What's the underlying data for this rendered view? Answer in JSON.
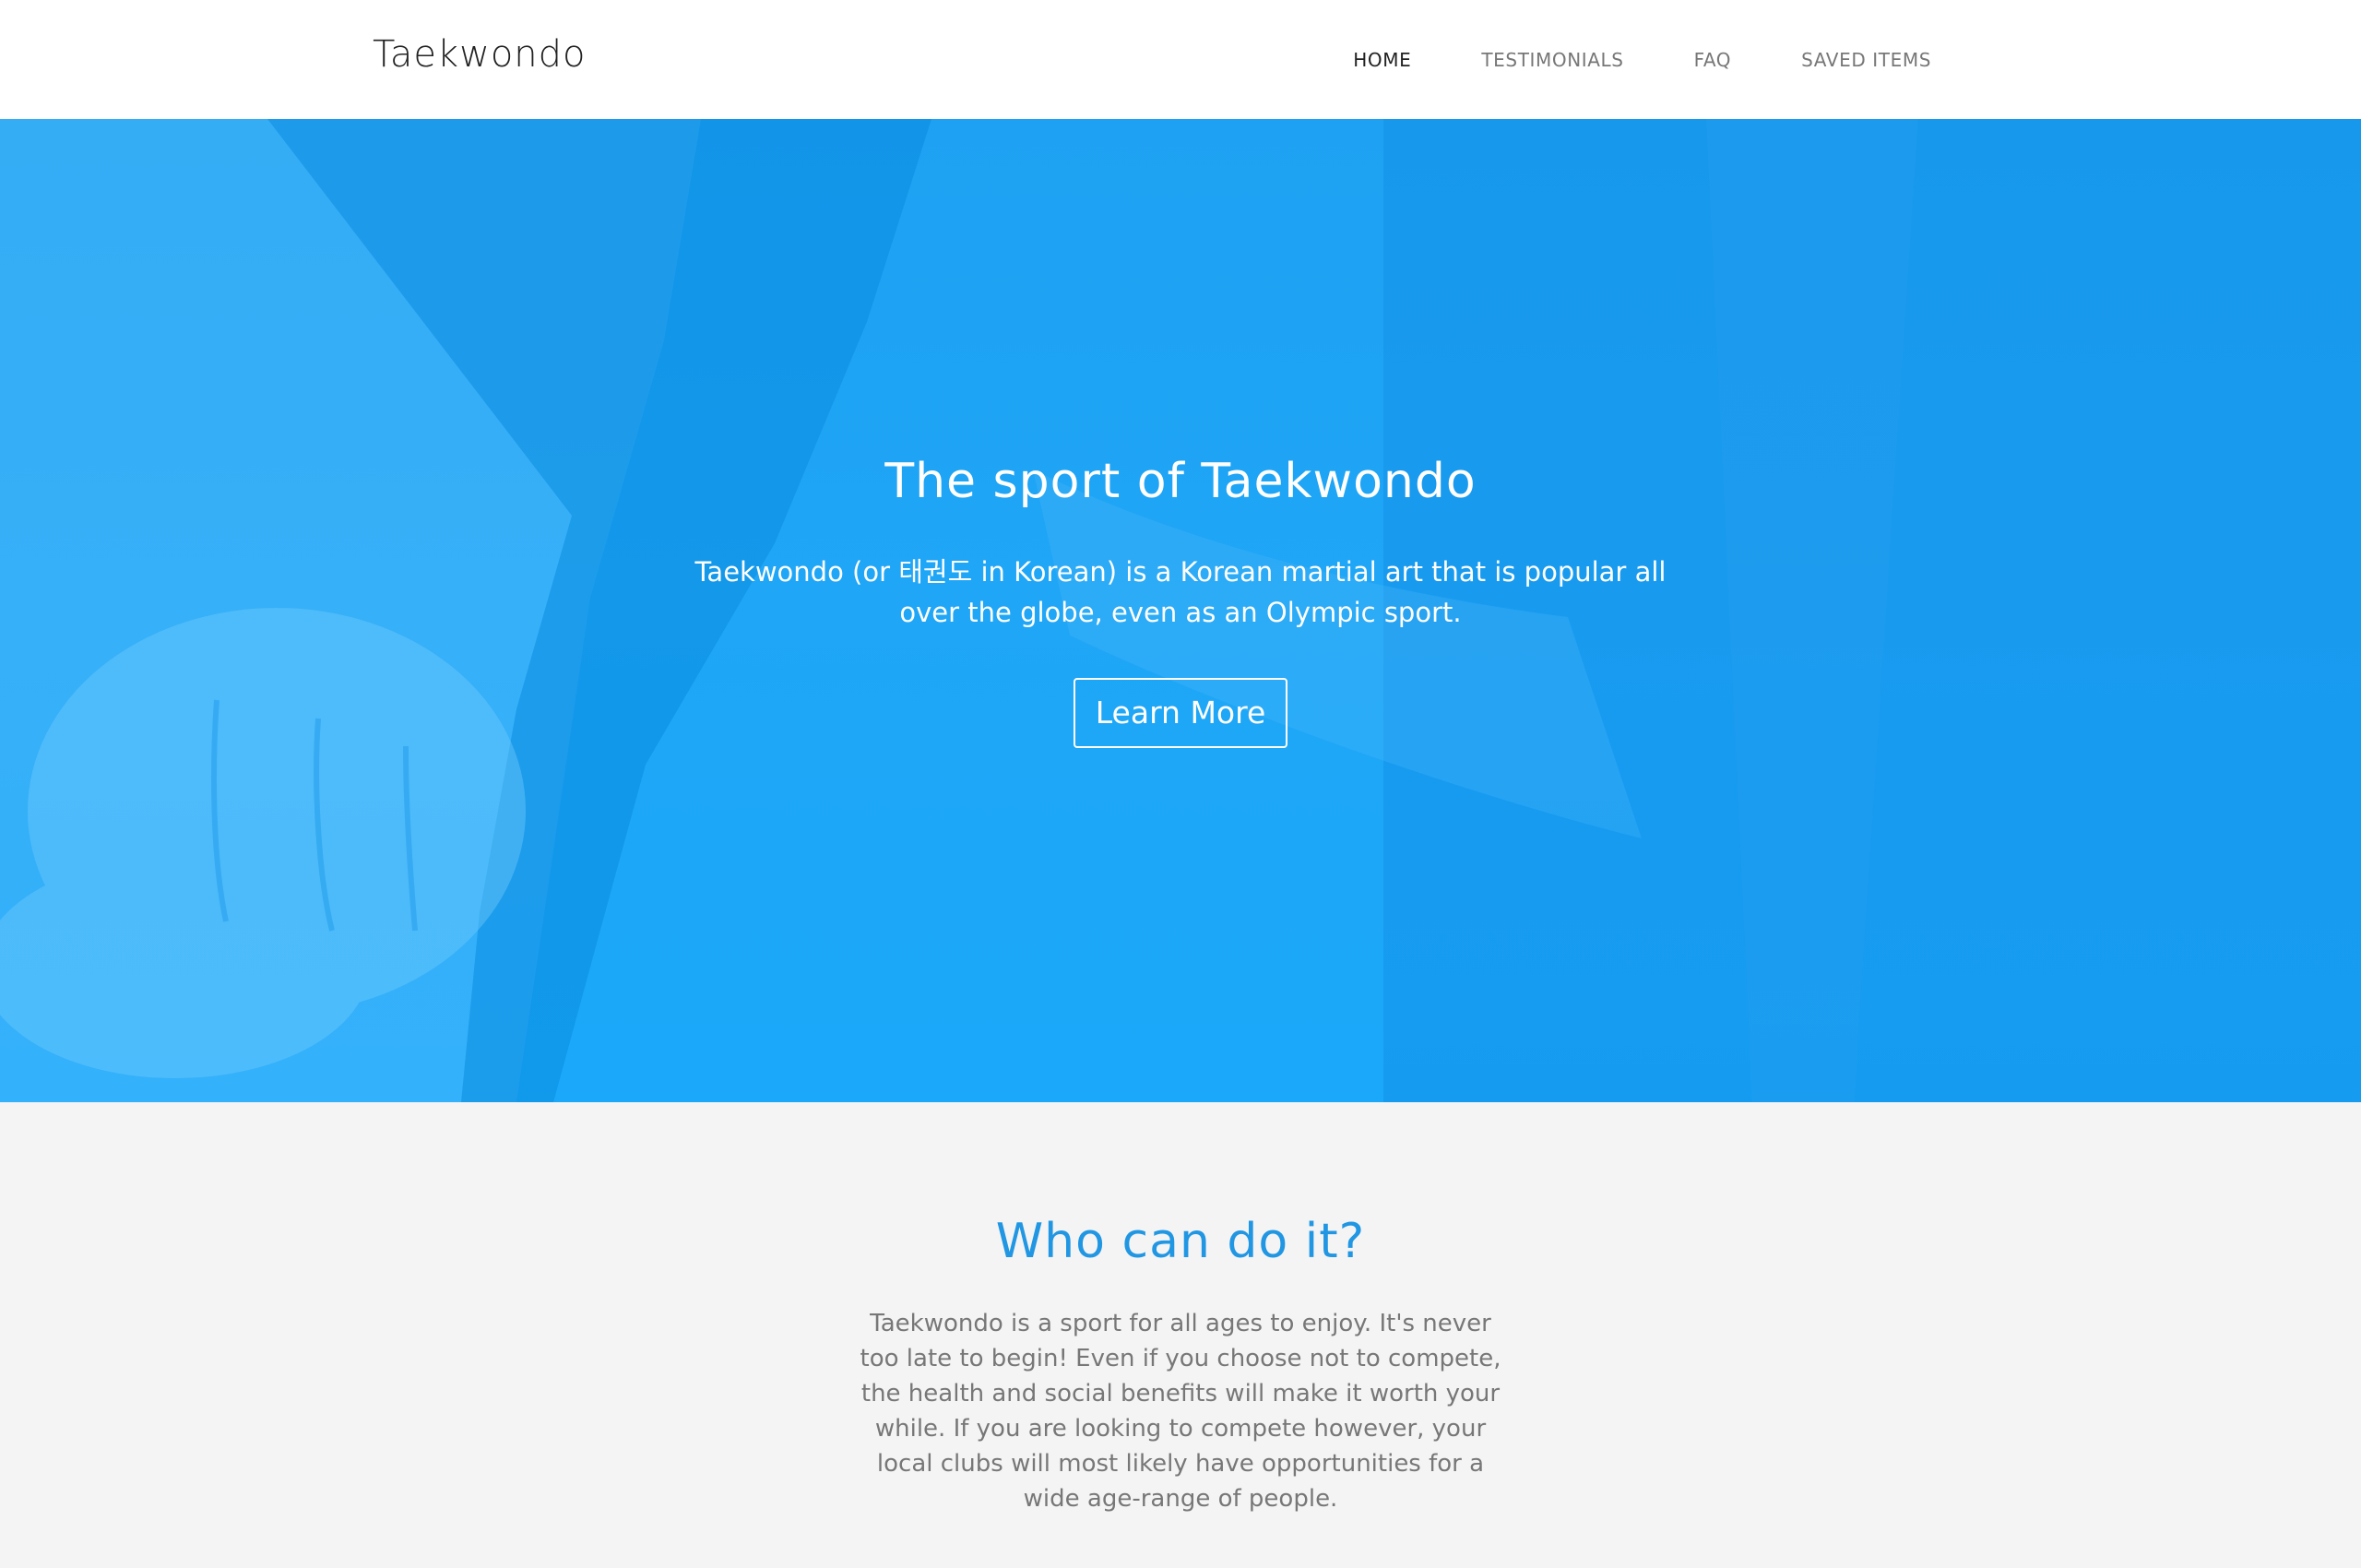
{
  "navbar": {
    "brand": "Taekwondo",
    "links": [
      {
        "label": "HOME",
        "active": true
      },
      {
        "label": "TESTIMONIALS",
        "active": false
      },
      {
        "label": "FAQ",
        "active": false
      },
      {
        "label": "SAVED ITEMS",
        "active": false
      }
    ]
  },
  "hero": {
    "title": "The sport of Taekwondo",
    "text": "Taekwondo (or 태권도 in Korean) is a Korean martial art that is popular all over the globe, even as an Olympic sport.",
    "button_label": "Learn More",
    "overlay_color": "#1fa6f6"
  },
  "who": {
    "title": "Who can do it?",
    "text": "Taekwondo is a sport for all ages to enjoy. It's never too late to begin! Even if you choose not to compete, the health and social benefits will make it worth your while. If you are looking to compete however, your local clubs will most likely have opportunities for a wide age-range of people.",
    "title_color": "#2196e3"
  }
}
